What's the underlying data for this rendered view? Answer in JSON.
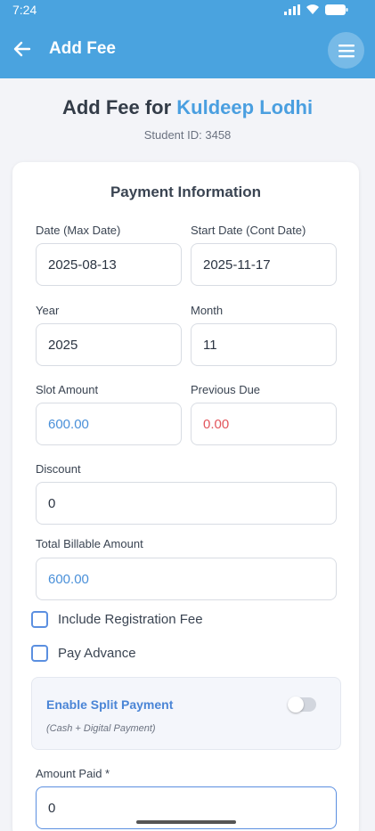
{
  "status_bar": {
    "time": "7:24"
  },
  "app_bar": {
    "title": "Add Fee"
  },
  "header": {
    "prefix": "Add Fee for",
    "student_name": "Kuldeep Lodhi",
    "student_id": "Student ID: 3458"
  },
  "card": {
    "title": "Payment Information",
    "date_max": {
      "label": "Date (Max Date)",
      "value": "2025-08-13"
    },
    "start_date": {
      "label": "Start Date (Cont Date)",
      "value": "2025-11-17"
    },
    "year": {
      "label": "Year",
      "value": "2025"
    },
    "month": {
      "label": "Month",
      "value": "11"
    },
    "slot_amount": {
      "label": "Slot Amount",
      "value": "600.00"
    },
    "previous_due": {
      "label": "Previous Due",
      "value": "0.00"
    },
    "discount": {
      "label": "Discount",
      "value": "0"
    },
    "total_billable": {
      "label": "Total Billable Amount",
      "value": "600.00"
    },
    "include_registration": "Include Registration Fee",
    "pay_advance": "Pay Advance",
    "split_payment": {
      "title": "Enable Split Payment",
      "subtitle": "(Cash + Digital Payment)",
      "enabled": false
    },
    "amount_paid": {
      "label": "Amount Paid *",
      "value": "0"
    }
  },
  "colors": {
    "primary": "#4aa3df",
    "accent_blue": "#4a90d9",
    "due_red": "#e2555c"
  }
}
